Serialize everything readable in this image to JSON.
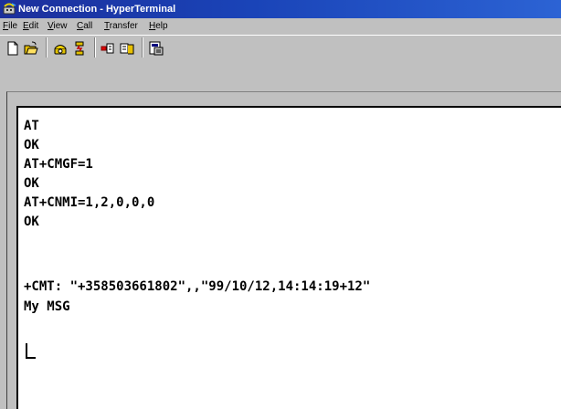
{
  "window": {
    "title": "New Connection - HyperTerminal",
    "app_icon": "hyperterminal-phone-icon"
  },
  "menu": [
    {
      "mnemonic": "F",
      "rest": "ile"
    },
    {
      "mnemonic": "E",
      "rest": "dit"
    },
    {
      "mnemonic": "V",
      "rest": "iew"
    },
    {
      "mnemonic": "C",
      "rest": "all"
    },
    {
      "mnemonic": "T",
      "rest": "ransfer"
    },
    {
      "mnemonic": "H",
      "rest": "elp"
    }
  ],
  "toolbar": {
    "buttons": [
      {
        "name": "new-icon"
      },
      {
        "name": "open-icon"
      },
      {
        "name": "connect-icon"
      },
      {
        "name": "disconnect-icon"
      },
      {
        "name": "send-icon"
      },
      {
        "name": "receive-icon"
      },
      {
        "name": "properties-icon"
      }
    ]
  },
  "terminal": {
    "lines": [
      "AT",
      "OK",
      "AT+CMGF=1",
      "OK",
      "AT+CNMI=1,2,0,0,0",
      "OK",
      "",
      "+CMT: \"+358503661802\",,\"99/10/12,14:14:19+12\"",
      "My MSG"
    ]
  },
  "colors": {
    "title_bar": "#1c2f9c",
    "title_text": "#ffffff",
    "chrome": "#c0c0c0",
    "terminal_bg": "#ffffff",
    "terminal_text": "#000000"
  }
}
